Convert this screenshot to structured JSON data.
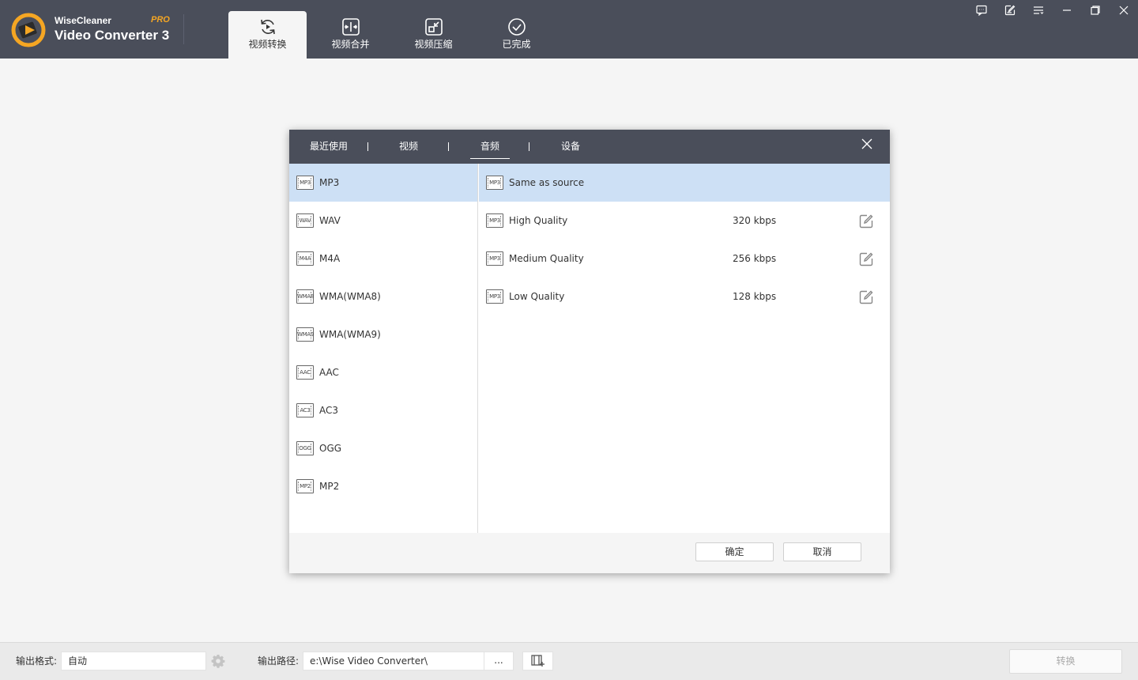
{
  "app": {
    "brand_line1": "WiseCleaner",
    "brand_line2": "Video Converter 3",
    "pro_badge": "PRO",
    "accent_color": "#f5a623",
    "titlebar_color": "#4a4e5a"
  },
  "nav_tabs": [
    {
      "label": "视频转换",
      "icon": "refresh-play-icon",
      "active": true
    },
    {
      "label": "视频合并",
      "icon": "merge-icon",
      "active": false
    },
    {
      "label": "视频压缩",
      "icon": "compress-icon",
      "active": false
    },
    {
      "label": "已完成",
      "icon": "check-circle-icon",
      "active": false
    }
  ],
  "window_controls": [
    "feedback-icon",
    "edit-note-icon",
    "menu-icon",
    "minimize-icon",
    "maximize-icon",
    "close-icon"
  ],
  "dialog": {
    "tabs": [
      {
        "label": "最近使用",
        "active": false
      },
      {
        "label": "视频",
        "active": false
      },
      {
        "label": "音频",
        "active": true
      },
      {
        "label": "设备",
        "active": false
      }
    ],
    "formats": [
      {
        "icon_text": "MP3",
        "label": "MP3",
        "selected": true
      },
      {
        "icon_text": "WAV",
        "label": "WAV",
        "selected": false
      },
      {
        "icon_text": "M4A",
        "label": "M4A",
        "selected": false
      },
      {
        "icon_text": "WMA8",
        "label": "WMA(WMA8)",
        "selected": false
      },
      {
        "icon_text": "WMA9",
        "label": "WMA(WMA9)",
        "selected": false
      },
      {
        "icon_text": "AAC",
        "label": "AAC",
        "selected": false
      },
      {
        "icon_text": "AC3",
        "label": "AC3",
        "selected": false
      },
      {
        "icon_text": "OGG",
        "label": "OGG",
        "selected": false
      },
      {
        "icon_text": "MP2",
        "label": "MP2",
        "selected": false
      }
    ],
    "presets": [
      {
        "icon_text": "MP3",
        "label": "Same as source",
        "bitrate": "",
        "editable": false,
        "selected": true
      },
      {
        "icon_text": "MP3",
        "label": "High Quality",
        "bitrate": "320 kbps",
        "editable": true,
        "selected": false
      },
      {
        "icon_text": "MP3",
        "label": "Medium Quality",
        "bitrate": "256 kbps",
        "editable": true,
        "selected": false
      },
      {
        "icon_text": "MP3",
        "label": "Low Quality",
        "bitrate": "128 kbps",
        "editable": true,
        "selected": false
      }
    ],
    "ok_label": "确定",
    "cancel_label": "取消",
    "selected_color": "#cde0f5"
  },
  "bottom": {
    "format_label": "输出格式:",
    "format_value": "自动",
    "path_label": "输出路径:",
    "path_value": "e:\\Wise Video Converter\\",
    "browse_label": "...",
    "convert_label": "转换"
  }
}
